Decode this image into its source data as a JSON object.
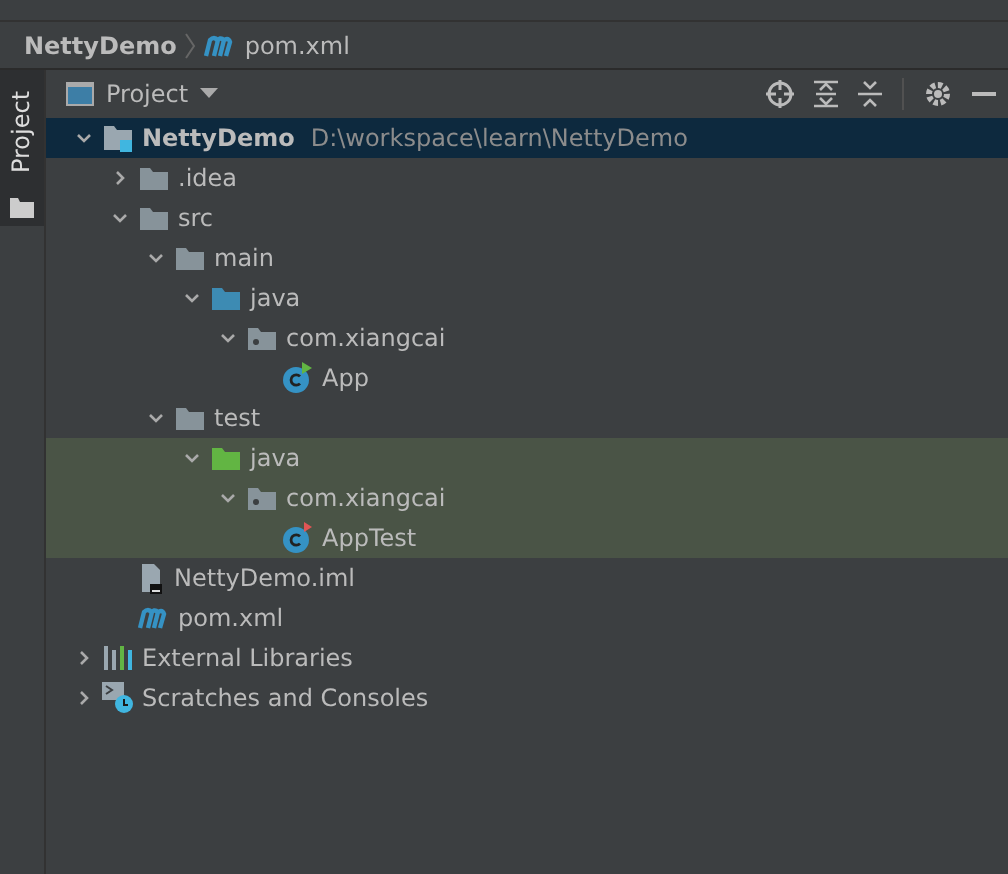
{
  "breadcrumb": [
    {
      "label": "NettyDemo",
      "kind": "project"
    },
    {
      "label": "pom.xml",
      "kind": "maven"
    }
  ],
  "side_tab": {
    "label": "Project",
    "selected": true
  },
  "panel": {
    "title": "Project"
  },
  "tree": [
    {
      "label": "NettyDemo",
      "path": "D:\\workspace\\learn\\NettyDemo",
      "kind": "module",
      "expanded": true,
      "selected": true,
      "tinted": false,
      "children": [
        {
          "label": ".idea",
          "kind": "folder",
          "expanded": false,
          "selected": false,
          "tinted": false
        },
        {
          "label": "src",
          "kind": "folder",
          "expanded": true,
          "selected": false,
          "tinted": false,
          "children": [
            {
              "label": "main",
              "kind": "folder",
              "expanded": true,
              "selected": false,
              "tinted": false,
              "children": [
                {
                  "label": "java",
                  "kind": "source",
                  "expanded": true,
                  "selected": false,
                  "tinted": false,
                  "children": [
                    {
                      "label": "com.xiangcai",
                      "kind": "package",
                      "expanded": true,
                      "selected": false,
                      "tinted": false,
                      "children": [
                        {
                          "label": "App",
                          "kind": "class",
                          "selected": false,
                          "tinted": false
                        }
                      ]
                    }
                  ]
                }
              ]
            },
            {
              "label": "test",
              "kind": "folder",
              "expanded": true,
              "selected": false,
              "tinted": false,
              "children": [
                {
                  "label": "java",
                  "kind": "test-source",
                  "expanded": true,
                  "selected": false,
                  "tinted": true,
                  "children": [
                    {
                      "label": "com.xiangcai",
                      "kind": "package",
                      "expanded": true,
                      "selected": false,
                      "tinted": true,
                      "children": [
                        {
                          "label": "AppTest",
                          "kind": "test-class",
                          "selected": false,
                          "tinted": true
                        }
                      ]
                    }
                  ]
                }
              ]
            }
          ]
        },
        {
          "label": "NettyDemo.iml",
          "kind": "iml",
          "selected": false,
          "tinted": false
        },
        {
          "label": "pom.xml",
          "kind": "maven",
          "selected": false,
          "tinted": false
        }
      ]
    },
    {
      "label": "External Libraries",
      "kind": "libraries",
      "expanded": false,
      "selected": false,
      "tinted": false
    },
    {
      "label": "Scratches and Consoles",
      "kind": "scratches",
      "expanded": false,
      "selected": false,
      "tinted": false
    }
  ]
}
